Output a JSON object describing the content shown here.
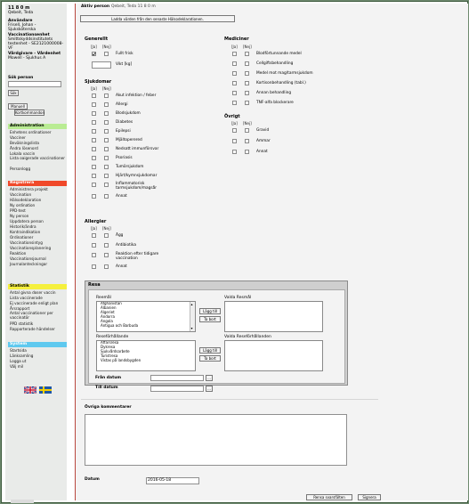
{
  "user": {
    "time": "11 8 0 m",
    "place": "Qebeit, Teda",
    "user_label": "Användare",
    "user_name": "Frisell, Johan -",
    "user_role": "Sjuksköterska",
    "unit_label": "Vaccinationsenhet",
    "unit_name1": "Smittskyddsinstitutets",
    "unit_name2": "testenhet - SE2121000008-",
    "unit_name3": "VF",
    "caregiver_label": "Vårdgivare - Vårdenhet",
    "caregiver_name": "Mowell - Sjukhus A"
  },
  "search": {
    "label": "Sök person",
    "button": "Sök",
    "manual_button": "Manuell",
    "card_button": "Kortkommandon"
  },
  "nav": {
    "admin": {
      "title": "Administration",
      "items": [
        "Enhetens ordinationer",
        "Vacciner",
        "Beväkningslista",
        "Ändra lösenord",
        "Lokala vaccin",
        "Lista oaigerade vaccinationer",
        "Personlogg"
      ]
    },
    "register": {
      "title": "Registrera",
      "items": [
        "Administrera projekt",
        "Vaccination",
        "Hälsodeklaration",
        "Ny ordination",
        "PPD-test",
        "Ny person",
        "Uppdatera person",
        "Historik/ändra",
        "Kontraindikation",
        "Ordinationer",
        "Vaccinationsintyg",
        "Vaccinationsplanering",
        "Reaktion",
        "Vaccinationsjournal",
        "Journalanteckningar"
      ]
    },
    "stats": {
      "title": "Statistik",
      "items": [
        "Antal givna doser vaccin",
        "Lista vaccinerade",
        "Ej vaccinerade enligt plan",
        "Årsrapport",
        "Antal vaccinationer per vaccinatör",
        "PPD statistik",
        "Rapporterade händelser"
      ]
    },
    "system": {
      "title": "System",
      "items": [
        "Startsida",
        "Länksamling",
        "Logga ut",
        "Välj mil"
      ]
    }
  },
  "header": {
    "active_person_label": "Aktiv person",
    "active_person_value": "Qebeit, Teda   11 8 0 m",
    "load_button": "Ladda värden från den senaste Hälsodeklarationen."
  },
  "col_labels": {
    "yes": "[Ja]",
    "no": "[Nej]"
  },
  "generellt": {
    "title": "Generellt",
    "items": [
      {
        "label": "Fullt frisk",
        "yes": true,
        "no": false
      },
      {
        "label": "Vikt [kg]",
        "value": ""
      }
    ]
  },
  "sjukdomar": {
    "title": "Sjukdomar",
    "items": [
      "Akut infektion / feber",
      "Allergi",
      "Blodsjukdom",
      "Diabetes",
      "Epilepsi",
      "Mjältoperered",
      "Nedsatt immunförsvar",
      "Psoriasis",
      "Tumörsjukdom",
      "Hjärt/kymnsjukdomar",
      "Inflammatorisk tarmsjukdom/magsår",
      "Annat"
    ]
  },
  "mediciner": {
    "title": "Mediciner",
    "items": [
      "Blodförtunnande medel",
      "Cellgiftsbehandling",
      "Medel mot mag/tarmsjukdom",
      "Kortisonbehandling (tabl.)",
      "Annan behandling",
      "TNF-alfa blockerare"
    ]
  },
  "ovrigt": {
    "title": "Övrigt",
    "items": [
      "Gravid",
      "Ammar",
      "Annat"
    ]
  },
  "allergier": {
    "title": "Allergier",
    "items": [
      "Ägg",
      "Antibiotika",
      "Reaktion efter tidigare vaccination",
      "Annat"
    ]
  },
  "resa": {
    "title": "Resa",
    "countries_label": "Reemål",
    "countries": [
      "Afghanistan",
      "Albanien",
      "Algeriet",
      "Andorra",
      "Angola",
      "Antigua och Barbuda"
    ],
    "selected_countries_label": "Valda Resmål",
    "add_button": "Lägg till",
    "remove_button": "Ta bort",
    "forms_label": "Reseförhållande",
    "forms": [
      "Affärsresa",
      "Dykresa",
      "Sjukvårdsarbete",
      "Turistresa",
      "Vistas på landsbygden"
    ],
    "selected_forms_label": "Valda Reseförhållanden",
    "from_label": "Från datum",
    "to_label": "Till datum",
    "date_btn": "..."
  },
  "comments": {
    "label": "Övriga kommentarer",
    "value": ""
  },
  "footer": {
    "date_label": "Datum",
    "date_value": "2016-05-18",
    "clear_button": "Rensa svarsfälten",
    "sign_button": "Signera"
  }
}
